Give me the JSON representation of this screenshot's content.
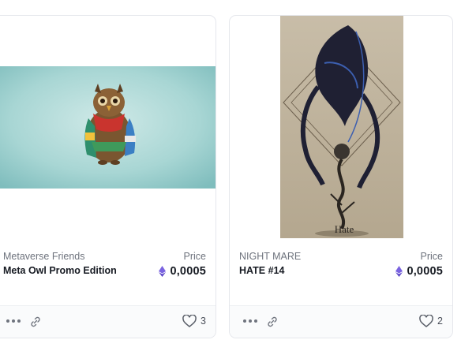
{
  "cards": [
    {
      "collection": "Metaverse Friends",
      "title": "Meta Owl Promo Edition",
      "price_label": "Price",
      "price": "0,0005",
      "likes": "3",
      "artwork_icon": "owl-artwork"
    },
    {
      "collection": "NIGHT MARE",
      "title": "HATE #14",
      "price_label": "Price",
      "price": "0,0005",
      "likes": "2",
      "artwork_icon": "hate-artwork",
      "artwork_caption": "Hate"
    }
  ],
  "colors": {
    "eth": "#6f5bd6",
    "card_border": "#e5e7ec",
    "text_primary": "#161a22",
    "text_secondary": "#6e737d",
    "owl_bg": "#8fc8c6"
  }
}
